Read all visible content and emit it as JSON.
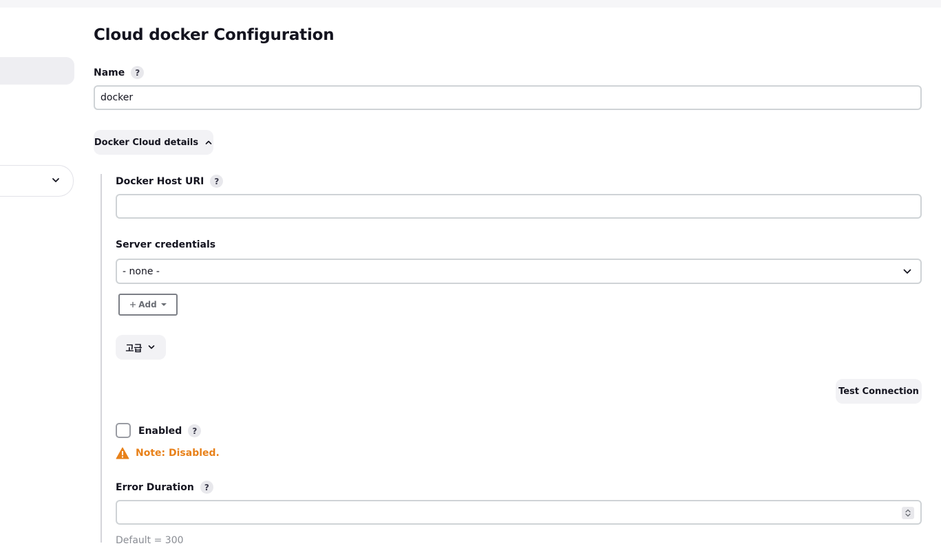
{
  "page": {
    "title": "Cloud docker Configuration"
  },
  "name_field": {
    "label": "Name",
    "help": "?",
    "value": "docker"
  },
  "details_toggle": {
    "label": "Docker Cloud details",
    "icon": "chevron-up-icon"
  },
  "docker_host_uri": {
    "label": "Docker Host URI",
    "help": "?",
    "value": ""
  },
  "server_credentials": {
    "label": "Server credentials",
    "selected": "- none -",
    "add_label": "Add",
    "add_icon": "plus-icon"
  },
  "advanced_toggle": {
    "label": "고급",
    "icon": "chevron-down-icon"
  },
  "test_connection": {
    "label": "Test Connection"
  },
  "enabled": {
    "label": "Enabled",
    "help": "?",
    "checked": false
  },
  "warning": {
    "text": "Note: Disabled.",
    "icon": "warning-icon",
    "color": "#e8811a"
  },
  "error_duration": {
    "label": "Error Duration",
    "help": "?",
    "value": "",
    "hint": "Default = 300"
  }
}
